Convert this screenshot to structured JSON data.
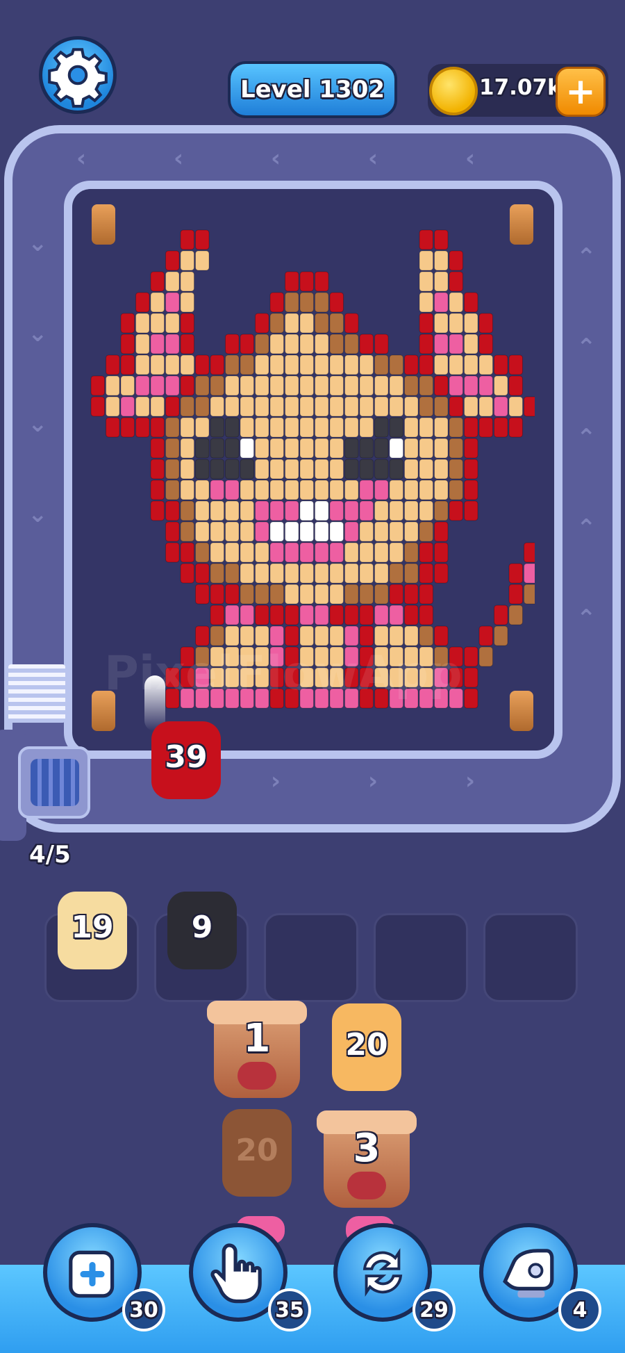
{
  "header": {
    "level_label": "Level 1302",
    "coins": "17.07k",
    "add_coins_label": "+"
  },
  "board": {
    "watermark": "PixelFlowApp"
  },
  "queue": {
    "capacity_label": "4/5",
    "active_shooter": {
      "count": "39",
      "color": "#c7101c"
    }
  },
  "slots": [
    {
      "count": "19",
      "color": "#f6dca0"
    },
    {
      "count": "9",
      "color": "#2c2c34"
    },
    {
      "count": "",
      "color": ""
    },
    {
      "count": "",
      "color": ""
    },
    {
      "count": "",
      "color": ""
    }
  ],
  "stack": [
    {
      "count": "1",
      "type": "cow"
    },
    {
      "count": "20",
      "type": "shooter",
      "color": "#f7b861"
    },
    {
      "count": "20",
      "type": "shooter",
      "color": "#9a5a2c"
    },
    {
      "count": "3",
      "type": "cow"
    }
  ],
  "boosters": [
    {
      "name": "add-slot-icon",
      "count": "30"
    },
    {
      "name": "hand-icon",
      "count": "35"
    },
    {
      "name": "shuffle-icon",
      "count": "29"
    },
    {
      "name": "rocket-icon",
      "count": "4"
    }
  ],
  "colors": {
    "accent": "#2f9ef0",
    "track": "#b9c4ee",
    "red": "#c7101c",
    "pink": "#ee5fa2",
    "tan": "#f6c98a",
    "brown": "#b0703e",
    "dark": "#3a3a44",
    "white": "#ffffff"
  }
}
